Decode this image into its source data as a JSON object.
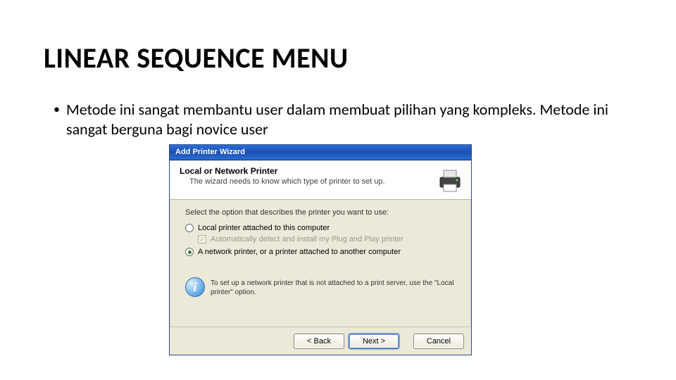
{
  "slide": {
    "title": "LINEAR SEQUENCE MENU",
    "bullet": "Metode ini sangat membantu user dalam membuat pilihan yang kompleks. Metode ini sangat berguna bagi novice user"
  },
  "wizard": {
    "window_title": "Add Printer Wizard",
    "header": {
      "title": "Local or Network Printer",
      "subtitle": "The wizard needs to know which type of printer to set up."
    },
    "prompt": "Select the option that describes the printer you want to use:",
    "options": {
      "local": "Local printer attached to this computer",
      "auto_detect": "Automatically detect and install my Plug and Play printer",
      "network": "A network printer, or a printer attached to another computer"
    },
    "info": {
      "glyph": "i",
      "text": "To set up a network printer that is not attached to a print server, use the \"Local printer\" option."
    },
    "buttons": {
      "back": "< Back",
      "next": "Next >",
      "cancel": "Cancel"
    },
    "auto_detect_checkmark": "✓"
  }
}
